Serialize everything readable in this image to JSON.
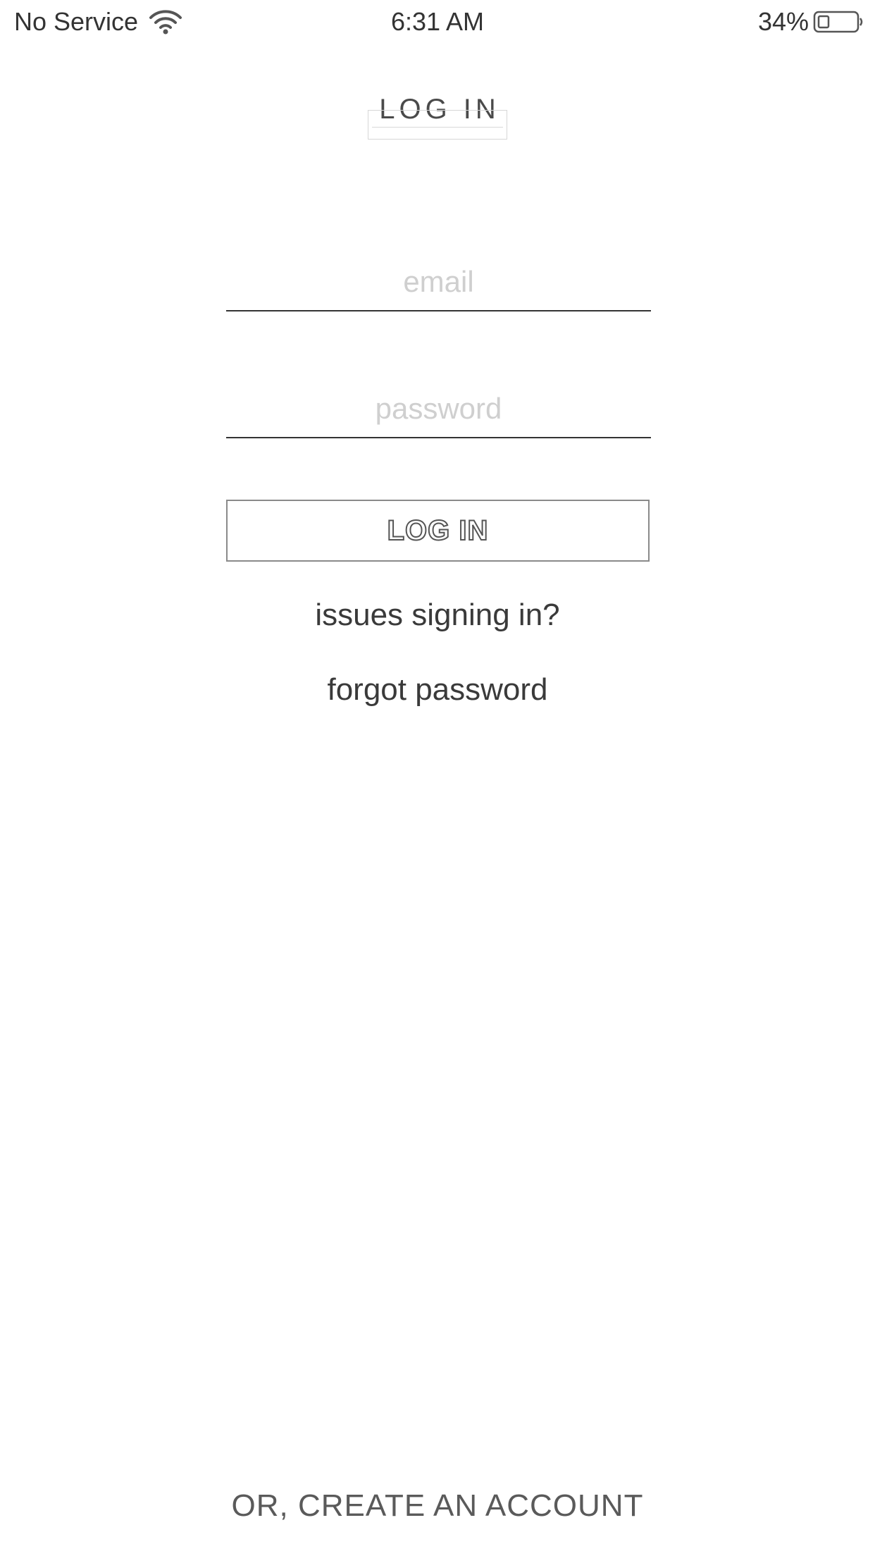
{
  "status_bar": {
    "carrier": "No Service",
    "time": "6:31 AM",
    "battery": "34%",
    "wifi_icon": "wifi-icon",
    "battery_icon": "battery-icon"
  },
  "header": {
    "title": "LOG IN"
  },
  "form": {
    "email_placeholder": "email",
    "email_value": "",
    "password_placeholder": "password",
    "password_value": "",
    "login_button_label": "LOG IN"
  },
  "links": {
    "issues": "issues signing in?",
    "forgot": "forgot password"
  },
  "footer": {
    "create_account": "OR, CREATE AN ACCOUNT"
  },
  "colors": {
    "text": "#333333",
    "placeholder": "#cfcfcf",
    "button_border": "#8a8a8a",
    "background": "#ffffff"
  }
}
